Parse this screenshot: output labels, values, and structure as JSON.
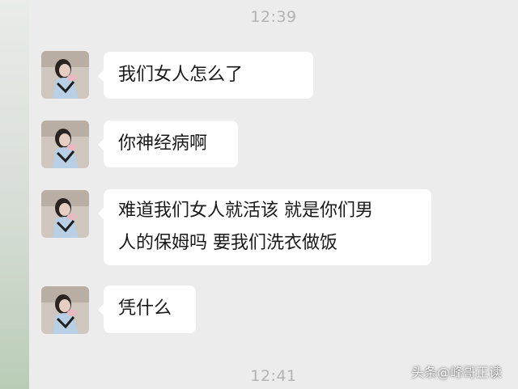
{
  "chat": {
    "timestamp_top": "12:39",
    "timestamp_bottom": "12:41",
    "messages": [
      {
        "lines": [
          "我们女人怎么了"
        ]
      },
      {
        "lines": [
          "你神经病啊"
        ]
      },
      {
        "lines": [
          "难道我们女人就活该 就是你们男",
          "人的保姆吗 要我们洗衣做饭"
        ]
      },
      {
        "lines": [
          "凭什么"
        ]
      }
    ]
  },
  "watermark": {
    "platform": "头条",
    "at_account": "@峰哥正读"
  },
  "colors": {
    "chat_background": "#ececec",
    "bubble": "#ffffff",
    "timestamp": "#b3b3b3"
  },
  "icons": {
    "avatar": "user-avatar-photo"
  }
}
